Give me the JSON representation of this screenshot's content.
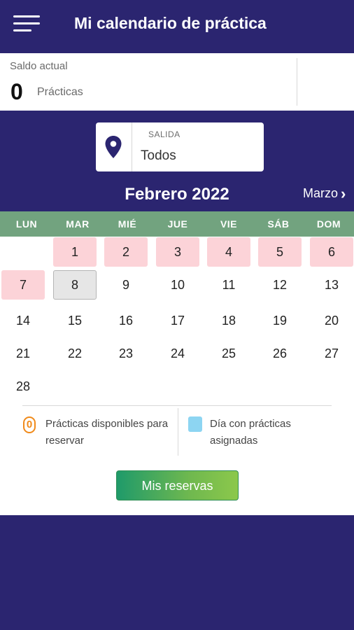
{
  "header": {
    "title": "Mi calendario de práctica",
    "menu_icon": "hamburger-menu-icon"
  },
  "balance": {
    "label": "Saldo actual",
    "count": "0",
    "unit": "Prácticas"
  },
  "departure": {
    "label": "SALIDA",
    "value": "Todos",
    "icon": "location-pin-icon"
  },
  "calendar": {
    "month": "Febrero 2022",
    "next_month": "Marzo",
    "weekdays": [
      "LUN",
      "MAR",
      "MIÉ",
      "JUE",
      "VIE",
      "SÁB",
      "DOM"
    ],
    "days": [
      {
        "n": "1",
        "state": "avail"
      },
      {
        "n": "2",
        "state": "avail"
      },
      {
        "n": "3",
        "state": "avail"
      },
      {
        "n": "4",
        "state": "avail"
      },
      {
        "n": "5",
        "state": "avail"
      },
      {
        "n": "6",
        "state": "avail"
      },
      {
        "n": "7",
        "state": "avail"
      },
      {
        "n": "8",
        "state": "today"
      },
      {
        "n": "9",
        "state": ""
      },
      {
        "n": "10",
        "state": ""
      },
      {
        "n": "11",
        "state": ""
      },
      {
        "n": "12",
        "state": ""
      },
      {
        "n": "13",
        "state": ""
      },
      {
        "n": "14",
        "state": ""
      },
      {
        "n": "15",
        "state": ""
      },
      {
        "n": "16",
        "state": ""
      },
      {
        "n": "17",
        "state": ""
      },
      {
        "n": "18",
        "state": ""
      },
      {
        "n": "19",
        "state": ""
      },
      {
        "n": "20",
        "state": ""
      },
      {
        "n": "21",
        "state": ""
      },
      {
        "n": "22",
        "state": ""
      },
      {
        "n": "23",
        "state": ""
      },
      {
        "n": "24",
        "state": ""
      },
      {
        "n": "25",
        "state": ""
      },
      {
        "n": "26",
        "state": ""
      },
      {
        "n": "27",
        "state": ""
      },
      {
        "n": "28",
        "state": ""
      }
    ]
  },
  "legend": {
    "available_badge": "0",
    "available_text": "Prácticas disponibles para reservar",
    "assigned_text": "Día con prácticas asignadas"
  },
  "actions": {
    "reservations_label": "Mis reservas"
  },
  "colors": {
    "primary": "#2b2570",
    "weekday_bar": "#72a37f",
    "available_day": "#fcd3d8",
    "assigned_day": "#8dd5f2",
    "badge": "#f08a1a"
  }
}
